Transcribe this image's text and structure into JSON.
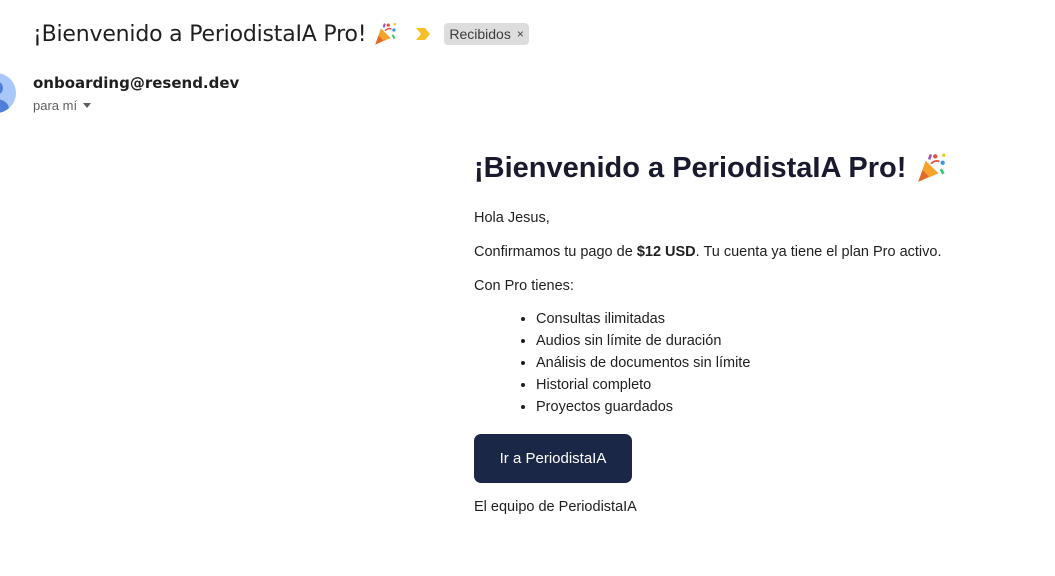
{
  "email": {
    "subject": "¡Bienvenido a PeriodistaIA Pro!",
    "subject_emoji": "party-popper-icon",
    "importance_icon": "importance-marker-icon",
    "label_chip": {
      "label": "Recibidos",
      "close": "×"
    },
    "sender": "onboarding@resend.dev",
    "to": "para mí",
    "body": {
      "heading": "¡Bienvenido a PeriodistaIA Pro!",
      "greeting": "Hola Jesus,",
      "confirm_prefix": "Confirmamos tu pago de ",
      "confirm_amount": "$12 USD",
      "confirm_suffix": ". Tu cuenta ya tiene el plan Pro activo.",
      "features_intro": "Con Pro tienes:",
      "features": [
        "Consultas ilimitadas",
        "Audios sin límite de duración",
        "Análisis de documentos sin límite",
        "Historial completo",
        "Proyectos guardados"
      ],
      "cta_label": "Ir a PeriodistaIA",
      "signature": "El equipo de PeriodistaIA"
    }
  },
  "colors": {
    "cta_background": "#1b2747",
    "importance_marker": "#f6c026",
    "avatar_background": "#a8c7fa",
    "chip_background": "#dddddd"
  }
}
